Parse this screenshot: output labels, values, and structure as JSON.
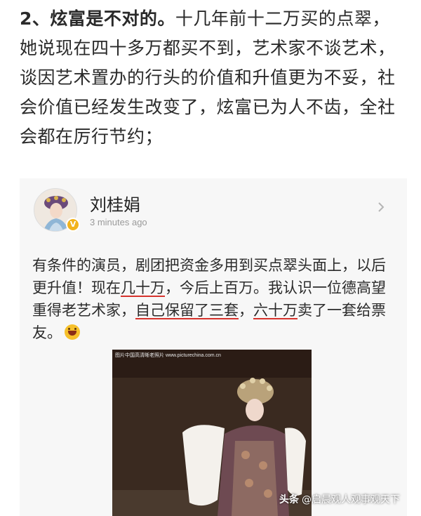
{
  "article": {
    "lead": "2、炫富是不对的。",
    "body": "十几年前十二万买的点翠，她说现在四十多万都买不到，艺术家不谈艺术，谈因艺术置办的行头的价值和升值更为不妥，社会价值已经发生改变了，炫富已为人不齿，全社会都在厉行节约；"
  },
  "post": {
    "user_name": "刘桂娟",
    "timestamp": "3 minutes ago",
    "text_1": "有条件的演员，剧团把资金多用到买点翠头面上，以后更升值！现在",
    "text_hl_1": "几十万",
    "text_2": "，今后上百万。我认识一位德高望重得老艺术家，",
    "text_hl_2": "自己保留了三套",
    "text_3": "，",
    "text_hl_3": "六十万",
    "text_4": "卖了一套给票友。",
    "emoji_icon": "grinning-face-icon",
    "photo_caption": "图片中国高清晰老照片  www.picturechina.com.cn"
  },
  "watermark": {
    "brand": "头条",
    "account": "@启晨观人观事观天下"
  },
  "colors": {
    "underline": "#d6322c",
    "verified": "#f2b31c",
    "card_bg": "#f7f7f7"
  }
}
